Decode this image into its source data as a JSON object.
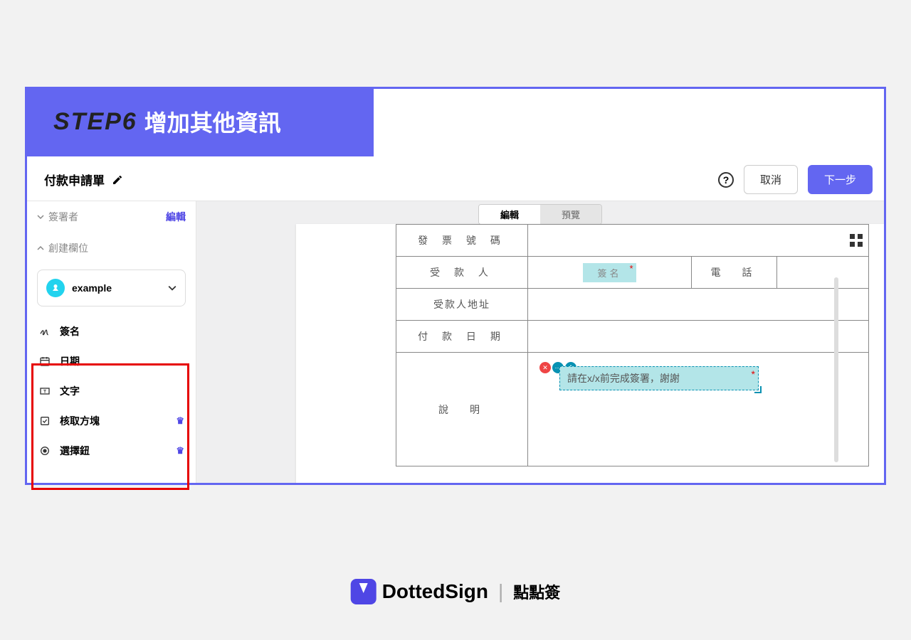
{
  "step": {
    "label": "STEP6",
    "title": "增加其他資訊"
  },
  "topbar": {
    "doc_title": "付款申請單",
    "cancel": "取消",
    "next": "下一步"
  },
  "sidebar": {
    "signers_label": "簽署者",
    "edit_link": "編輯",
    "create_fields_label": "創建欄位",
    "signer_name": "example",
    "fields": {
      "signature": "簽名",
      "date": "日期",
      "text": "文字",
      "checkbox": "核取方塊",
      "radio": "選擇鈕"
    }
  },
  "tabs": {
    "edit": "編輯",
    "preview": "預覽"
  },
  "doc": {
    "row1": "發 票 號 碼",
    "row2": "受 款 人",
    "row2_phone": "電　話",
    "row3": "受款人地址",
    "row4": "付 款 日 期",
    "row5": "說　明",
    "sig_placeholder": "簽名",
    "text_placeholder": "請在x/x前完成簽署，謝謝"
  },
  "footer": {
    "brand": "DottedSign",
    "brand_cn": "點點簽"
  }
}
